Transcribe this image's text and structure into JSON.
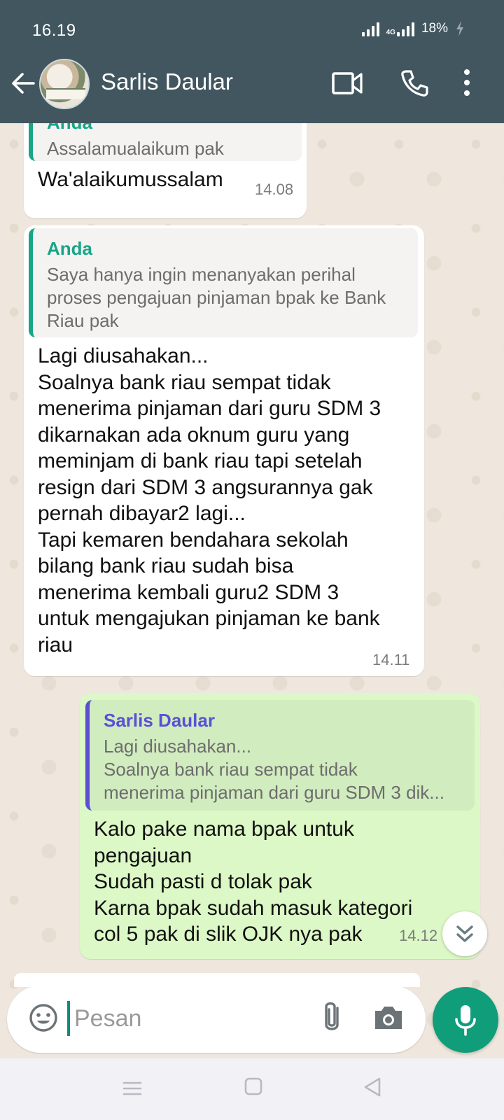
{
  "status_bar": {
    "time": "16.19",
    "network": "4G",
    "battery": "18%"
  },
  "header": {
    "contact_name": "Sarlis Daular",
    "bg_color": "#41565f"
  },
  "icons": {
    "back": "arrow-left-icon",
    "video": "video-camera-icon",
    "call": "phone-icon",
    "more": "more-vertical-icon",
    "emoji": "emoji-icon",
    "attach": "paperclip-icon",
    "camera": "camera-icon",
    "mic": "microphone-icon",
    "scroll_down": "double-chevron-down-icon"
  },
  "messages": [
    {
      "direction": "incoming",
      "quote": {
        "author": "Anda",
        "text": "Assalamualaikum pak"
      },
      "text": "Wa'alaikumussalam",
      "time": "14.08"
    },
    {
      "direction": "incoming",
      "quote": {
        "author": "Anda",
        "text": "Saya hanya ingin menanyakan perihal\nproses pengajuan pinjaman bpak ke Bank\nRiau pak"
      },
      "text": "Lagi diusahakan...\nSoalnya bank riau sempat tidak\nmenerima pinjaman dari guru SDM 3\ndikarnakan ada oknum guru yang\nmeminjam di bank riau tapi setelah\nresign dari SDM 3 angsurannya gak\npernah dibayar2 lagi...\nTapi kemaren bendahara sekolah\nbilang bank riau sudah bisa\nmenerima kembali guru2 SDM 3\nuntuk mengajukan pinjaman ke bank\nriau",
      "time": "14.11"
    },
    {
      "direction": "outgoing",
      "quote": {
        "author": "Sarlis Daular",
        "text": "Lagi diusahakan...\nSoalnya bank riau sempat tidak\nmenerima pinjaman dari guru SDM 3 dik..."
      },
      "text": "Kalo pake nama bpak untuk\npengajuan\nSudah pasti d tolak pak\nKarna bpak sudah masuk kategori\ncol 5 pak di slik OJK nya pak",
      "time": "14.12"
    }
  ],
  "composer": {
    "placeholder": "Pesan"
  },
  "colors": {
    "incoming": "#ffffff",
    "outgoing": "#dcf8c6",
    "accent": "#0f9d7a",
    "quote_green": "#17a687",
    "quote_purple": "#5b4fd6"
  }
}
